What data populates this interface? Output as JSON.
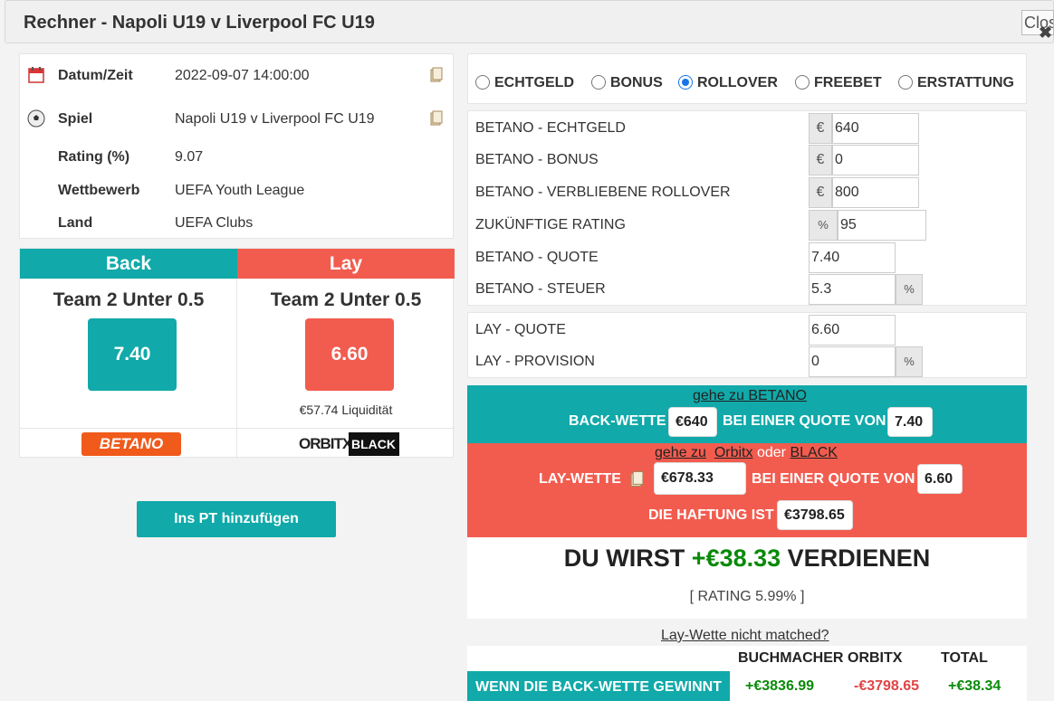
{
  "window": {
    "title": "Rechner - Napoli U19 v Liverpool FC U19",
    "close_label": "Close",
    "close_glyph": "✖"
  },
  "info": {
    "datetime_label": "Datum/Zeit",
    "datetime_value": "2022-09-07 14:00:00",
    "match_label": "Spiel",
    "match_value": "Napoli U19 v Liverpool FC U19",
    "rating_label": "Rating (%)",
    "rating_value": "9.07",
    "competition_label": "Wettbewerb",
    "competition_value": "UEFA Youth League",
    "country_label": "Land",
    "country_value": "UEFA Clubs"
  },
  "back": {
    "header": "Back",
    "team": "Team 2 Unter 0.5",
    "odds": "7.40",
    "bookmaker_logo": "BETANO",
    "color": "#11a9a9"
  },
  "lay": {
    "header": "Lay",
    "team": "Team 2 Unter 0.5",
    "odds": "6.60",
    "liquidity": "€57.74 Liquidität",
    "exchange_logo_a": "ORBITX",
    "exchange_logo_b": "BLACK",
    "color": "#f25c4f"
  },
  "add_pt_button": "Ins PT hinzufügen",
  "modes": [
    {
      "label": "ECHTGELD",
      "selected": false
    },
    {
      "label": "BONUS",
      "selected": false
    },
    {
      "label": "ROLLOVER",
      "selected": true
    },
    {
      "label": "FREEBET",
      "selected": false
    },
    {
      "label": "ERSTATTUNG",
      "selected": false
    }
  ],
  "fields": {
    "real_money_label": "BETANO - ECHTGELD",
    "real_money_value": "640",
    "bonus_label": "BETANO - BONUS",
    "bonus_value": "0",
    "rollover_label": "BETANO - VERBLIEBENE ROLLOVER",
    "rollover_value": "800",
    "future_rating_label": "ZUKÜNFTIGE RATING",
    "future_rating_value": "95",
    "back_odds_label": "BETANO - QUOTE",
    "back_odds_value": "7.40",
    "tax_label": "BETANO - STEUER",
    "tax_value": "5.3",
    "lay_odds_label": "LAY - QUOTE",
    "lay_odds_value": "6.60",
    "commission_label": "LAY - PROVISION",
    "commission_value": "0",
    "currency": "€",
    "percent": "%"
  },
  "back_instruction": {
    "goto_link": "gehe zu BETANO",
    "bet_label": "BACK-WETTE",
    "stake": "€640",
    "at_odds_label": "BEI EINER QUOTE VON",
    "odds": "7.40"
  },
  "lay_instruction": {
    "goto_prefix": "gehe zu",
    "goto_link_a": "Orbitx",
    "goto_middle": "oder",
    "goto_link_b": "BLACK",
    "bet_label": "LAY-WETTE",
    "stake": "€678.33",
    "at_odds_label": "BEI EINER QUOTE VON",
    "odds": "6.60",
    "liability_label": "DIE HAFTUNG IST",
    "liability": "€3798.65"
  },
  "result": {
    "prefix": "DU WIRST",
    "amount": "+€38.33",
    "suffix": "VERDIENEN",
    "rating": "[ RATING 5.99% ]"
  },
  "unmatched_link": "Lay-Wette nicht matched?",
  "summary": {
    "headers": [
      "BUCHMACHER",
      "ORBITX",
      "TOTAL"
    ],
    "row_label": "WENN DIE BACK-WETTE GEWINNT",
    "bookmaker": "+€3836.99",
    "exchange": "-€3798.65",
    "total": "+€38.34"
  }
}
